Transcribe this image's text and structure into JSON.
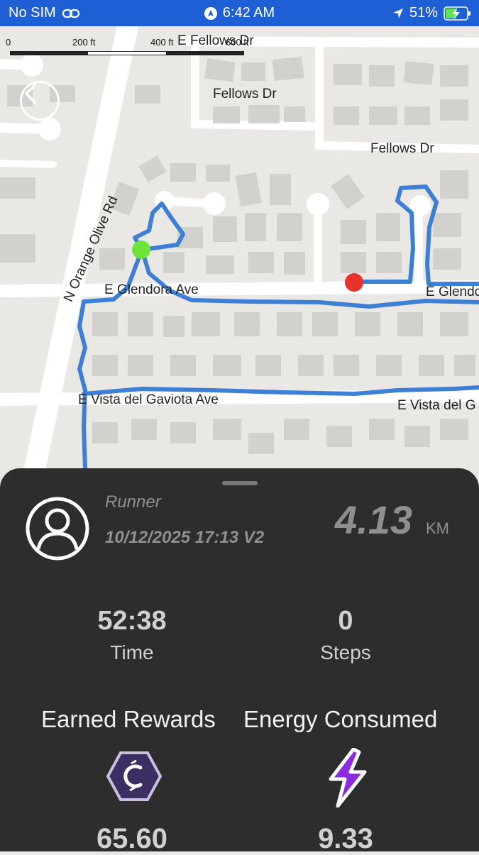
{
  "status_bar": {
    "carrier": "No SIM",
    "time": "6:42 AM",
    "battery_percent": "51%",
    "battery_level": 0.51
  },
  "map": {
    "scale_labels": [
      "0",
      "200 ft",
      "400 ft",
      "600 ft"
    ],
    "streets": {
      "fellows_top": "E Fellows Dr",
      "fellows_1": "Fellows Dr",
      "fellows_2": "Fellows Dr",
      "olive": "N Orange Olive Rd",
      "glendora_w": "E Glendora Ave",
      "glendora_e": "E Glendo",
      "gaviota_w": "E Vista del Gaviota Ave",
      "gaviota_e": "E Vista del G"
    },
    "route_color": "#3d7fd6",
    "start_color": "#6ee33a",
    "end_color": "#e8322b"
  },
  "summary": {
    "user": "Runner",
    "date_version": "10/12/2025 17:13 V2",
    "distance": "4.13",
    "distance_unit": "KM",
    "time_value": "52:38",
    "time_label": "Time",
    "steps_value": "0",
    "steps_label": "Steps",
    "rewards_label": "Earned Rewards",
    "rewards_value": "65.60",
    "energy_label": "Energy Consumed",
    "energy_value": "9.33"
  }
}
